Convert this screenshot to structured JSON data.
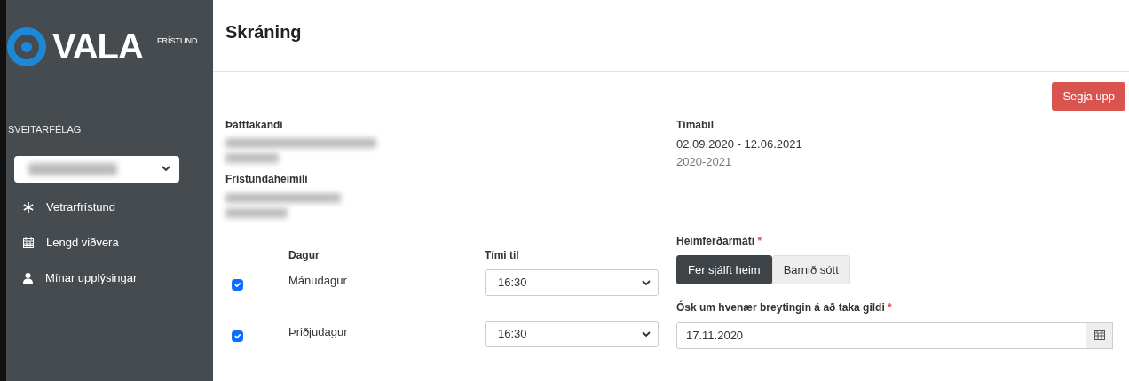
{
  "sidebar": {
    "logo": {
      "name": "VALA",
      "tag": "FRÍSTUND"
    },
    "section_label": "SVEITARFÉLAG",
    "items": [
      {
        "label": "Vetrarfrístund"
      },
      {
        "label": "Lengd viðvera"
      },
      {
        "label": "Mínar upplýsingar"
      }
    ]
  },
  "header": {
    "title": "Skráning"
  },
  "actions": [
    {
      "label": "Segja upp"
    }
  ],
  "participant": {
    "label": "Þátttakandi"
  },
  "center": {
    "label": "Frístundaheimili"
  },
  "period": {
    "label": "Tímabil",
    "dates": "02.09.2020 - 12.06.2021",
    "season": "2020-2021"
  },
  "days": {
    "columns": [
      "Dagur",
      "Tími til"
    ],
    "rows": [
      {
        "checked": true,
        "day": "Mánudagur",
        "time": "16:30"
      },
      {
        "checked": true,
        "day": "Þriðjudagur",
        "time": "16:30"
      }
    ]
  },
  "transport": {
    "label": "Heimferðarmáti",
    "required_mark": "*",
    "options": [
      {
        "label": "Fer sjálft heim",
        "selected": true
      },
      {
        "label": "Barnið sótt",
        "selected": false
      }
    ]
  },
  "start_date": {
    "label": "Ósk um hvenær breytingin á að taka gildi",
    "required_mark": "*",
    "value": "17.11.2020"
  }
}
